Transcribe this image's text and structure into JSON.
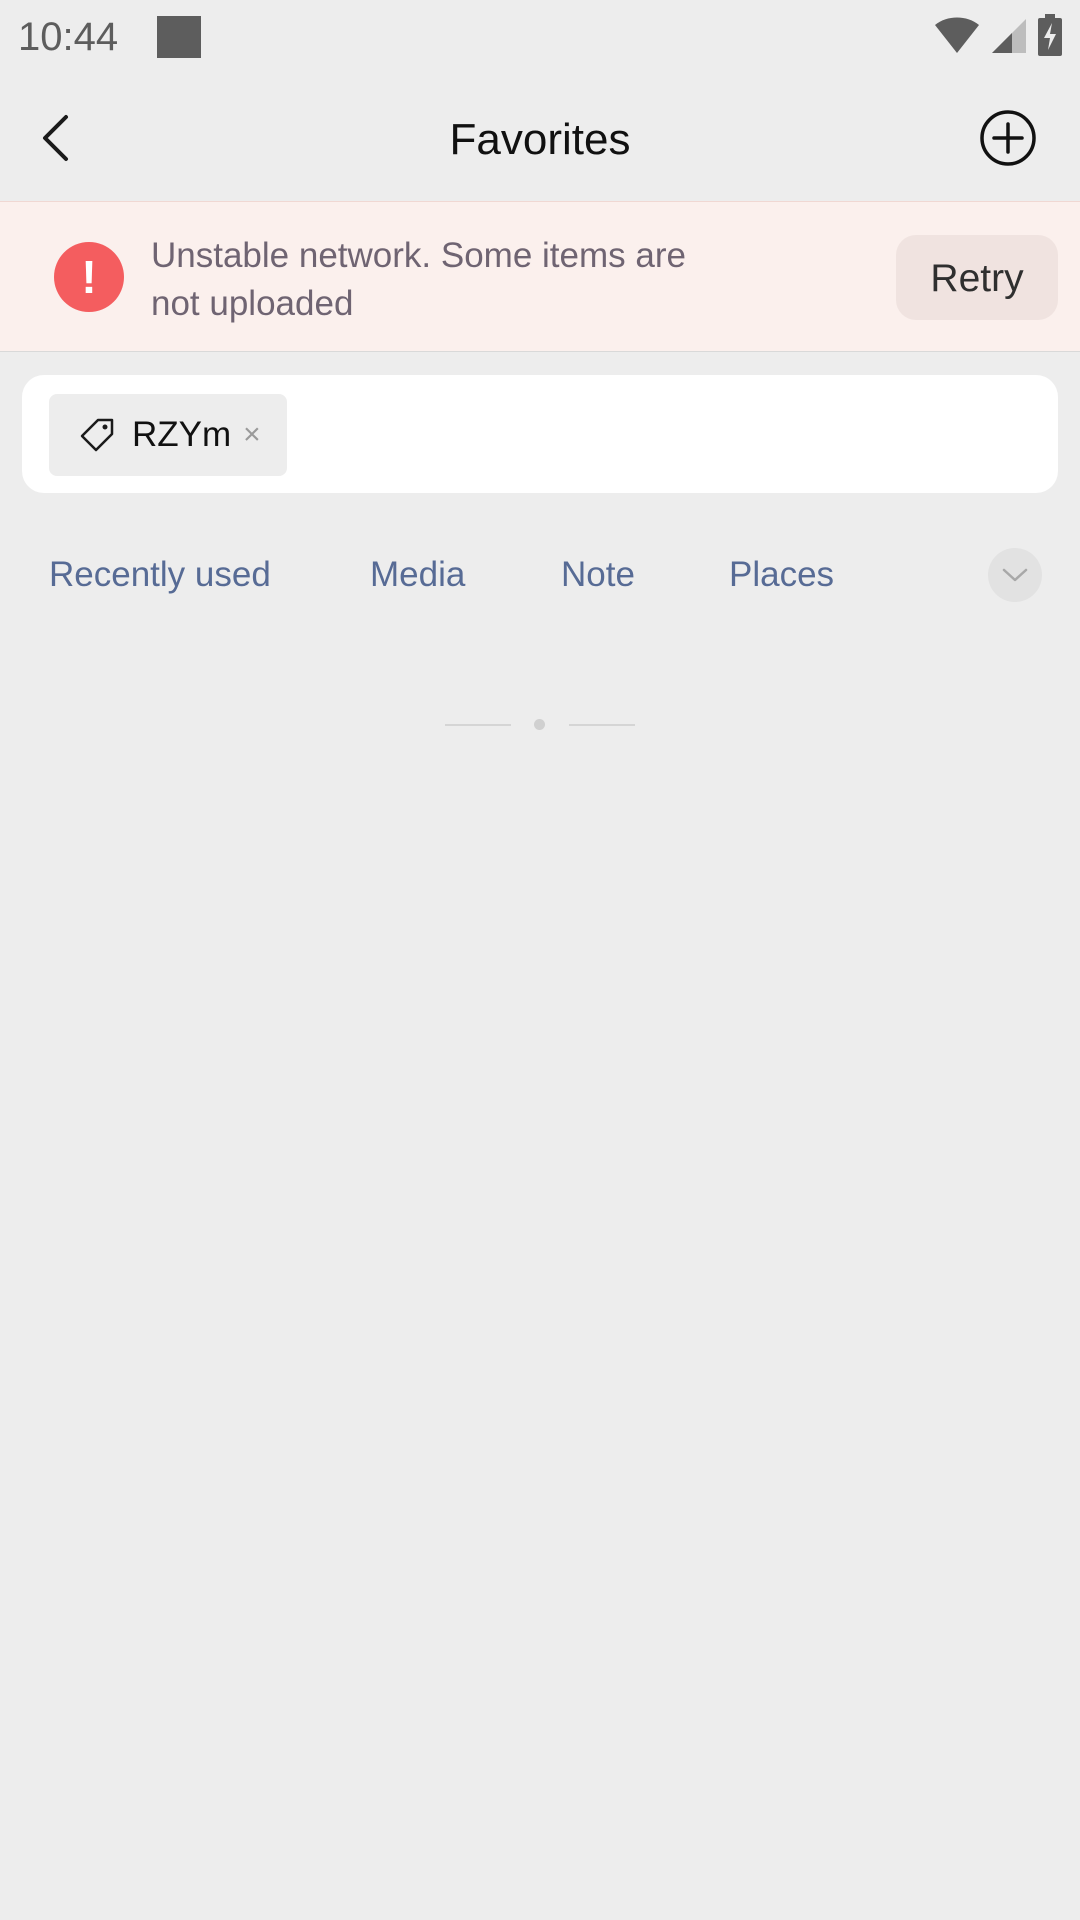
{
  "status_bar": {
    "time": "10:44",
    "icons": [
      "square-notification-icon",
      "wifi-icon",
      "cell-signal-icon",
      "battery-charging-icon"
    ]
  },
  "header": {
    "title": "Favorites",
    "back_icon": "chevron-left-icon",
    "add_icon": "plus-circle-icon"
  },
  "alert": {
    "icon": "exclamation-icon",
    "icon_glyph": "!",
    "message": "Unstable network. Some items are not uploaded",
    "retry_label": "Retry",
    "color": "#f45d5f"
  },
  "search": {
    "tags": [
      {
        "label": "RZYm",
        "icon": "tag-icon",
        "remove_glyph": "×"
      }
    ]
  },
  "categories": {
    "items": [
      "Recently used",
      "Media",
      "Note",
      "Places"
    ],
    "expand_icon": "chevron-down-icon",
    "color": "#576b95"
  }
}
